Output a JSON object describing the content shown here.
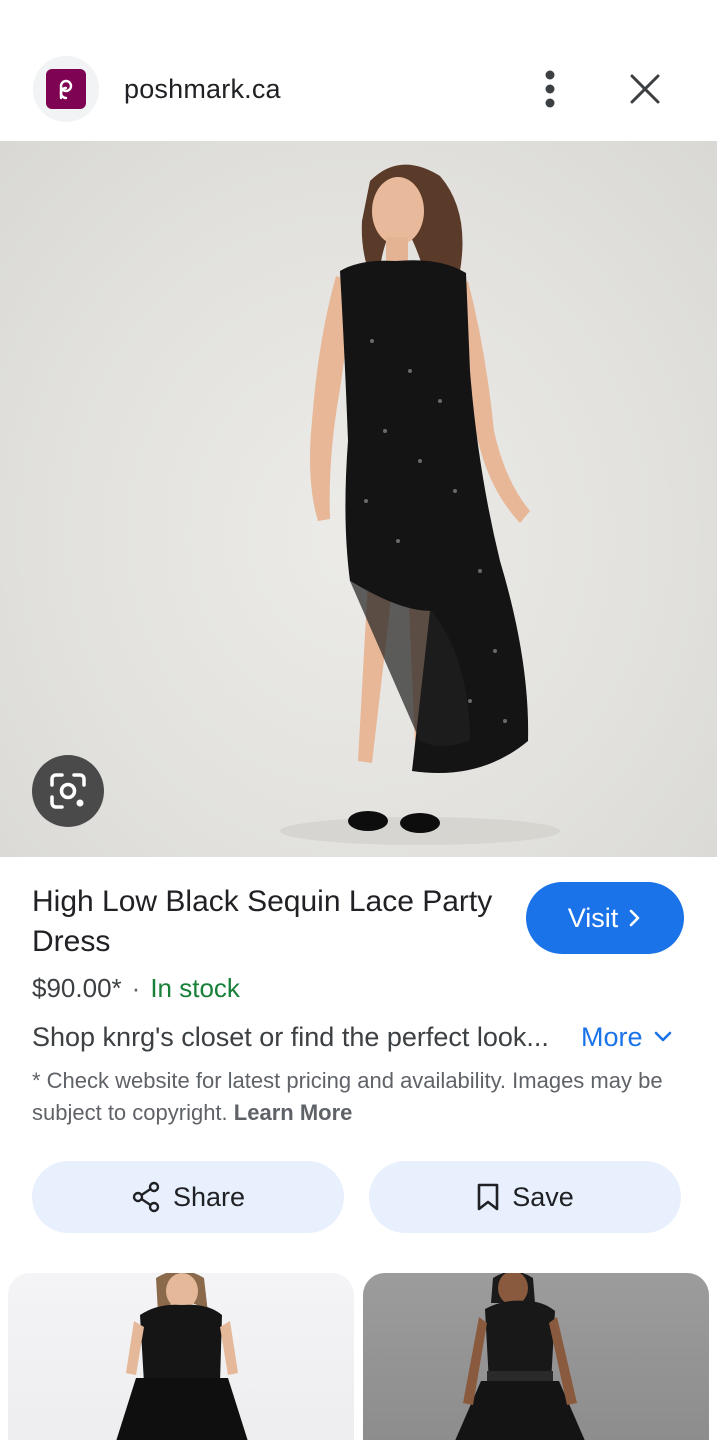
{
  "header": {
    "site_name": "poshmark.ca",
    "logo_icon": "poshmark-logo-icon",
    "brand_color": "#7f0353"
  },
  "hero": {
    "image_desc_icon": "product-photo",
    "lens_icon": "google-lens-icon"
  },
  "product": {
    "title": "High Low Black Sequin Lace Party Dress",
    "price": "$90.00*",
    "separator": "·",
    "stock": "In stock",
    "description": "Shop knrg's closet or find the perfect look...",
    "more_label": "More",
    "disclaimer": "* Check website for latest pricing and availability. Images may be subject to copyright.",
    "learn_more": "Learn More",
    "visit_label": "Visit"
  },
  "actions": {
    "share_label": "Share",
    "save_label": "Save"
  },
  "colors": {
    "accent": "#1a73e8",
    "stock": "#188038",
    "action_bg": "#e8f0fe"
  }
}
